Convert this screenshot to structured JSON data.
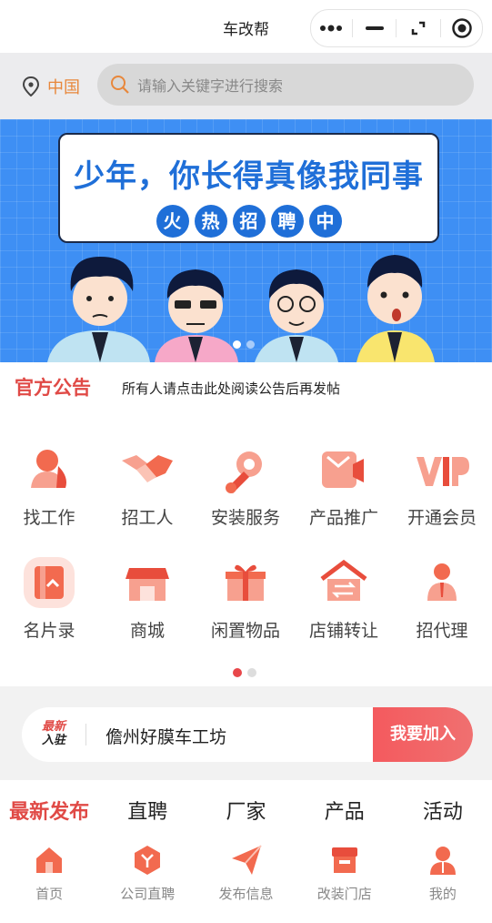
{
  "app": {
    "title": "车改帮"
  },
  "capsule": {
    "more_icon": "more-dots-icon",
    "minimize_icon": "minimize-icon",
    "expand_icon": "expand-icon",
    "close_icon": "target-icon"
  },
  "location": {
    "label": "中国",
    "icon": "location-pin-icon"
  },
  "search": {
    "placeholder": "请输入关键字进行搜索",
    "icon": "search-icon"
  },
  "banner": {
    "headline": "少年，你长得真像我同事",
    "pills": [
      "火",
      "热",
      "招",
      "聘",
      "中"
    ],
    "slide_count": 2,
    "active_slide": 0
  },
  "notice": {
    "title": "官方公告",
    "text": "所有人请点击此处阅读公告后再发帖"
  },
  "menu": {
    "items": [
      {
        "label": "找工作",
        "icon": "person-icon"
      },
      {
        "label": "招工人",
        "icon": "handshake-icon"
      },
      {
        "label": "安装服务",
        "icon": "gear-wrench-icon"
      },
      {
        "label": "产品推广",
        "icon": "megaphone-icon"
      },
      {
        "label": "开通会员",
        "icon": "vip-icon"
      },
      {
        "label": "名片录",
        "icon": "card-icon"
      },
      {
        "label": "商城",
        "icon": "store-icon"
      },
      {
        "label": "闲置物品",
        "icon": "gift-icon"
      },
      {
        "label": "店铺转让",
        "icon": "house-transfer-icon"
      },
      {
        "label": "招代理",
        "icon": "agent-icon"
      }
    ],
    "page_count": 2,
    "active_page": 0
  },
  "join": {
    "badge_top": "最新",
    "badge_bottom": "入驻",
    "shop": "儋州好膜车工坊",
    "button": "我要加入"
  },
  "tabs": [
    "最新发布",
    "直聘",
    "厂家",
    "产品",
    "活动"
  ],
  "bottom_nav": [
    {
      "label": "首页",
      "icon": "home-icon"
    },
    {
      "label": "公司直聘",
      "icon": "company-icon"
    },
    {
      "label": "发布信息",
      "icon": "send-icon"
    },
    {
      "label": "改装门店",
      "icon": "shop-icon"
    },
    {
      "label": "我的",
      "icon": "user-icon"
    }
  ],
  "colors": {
    "accent": "#e04a46",
    "icon": "#f26a4f",
    "banner": "#3e8ff4"
  }
}
